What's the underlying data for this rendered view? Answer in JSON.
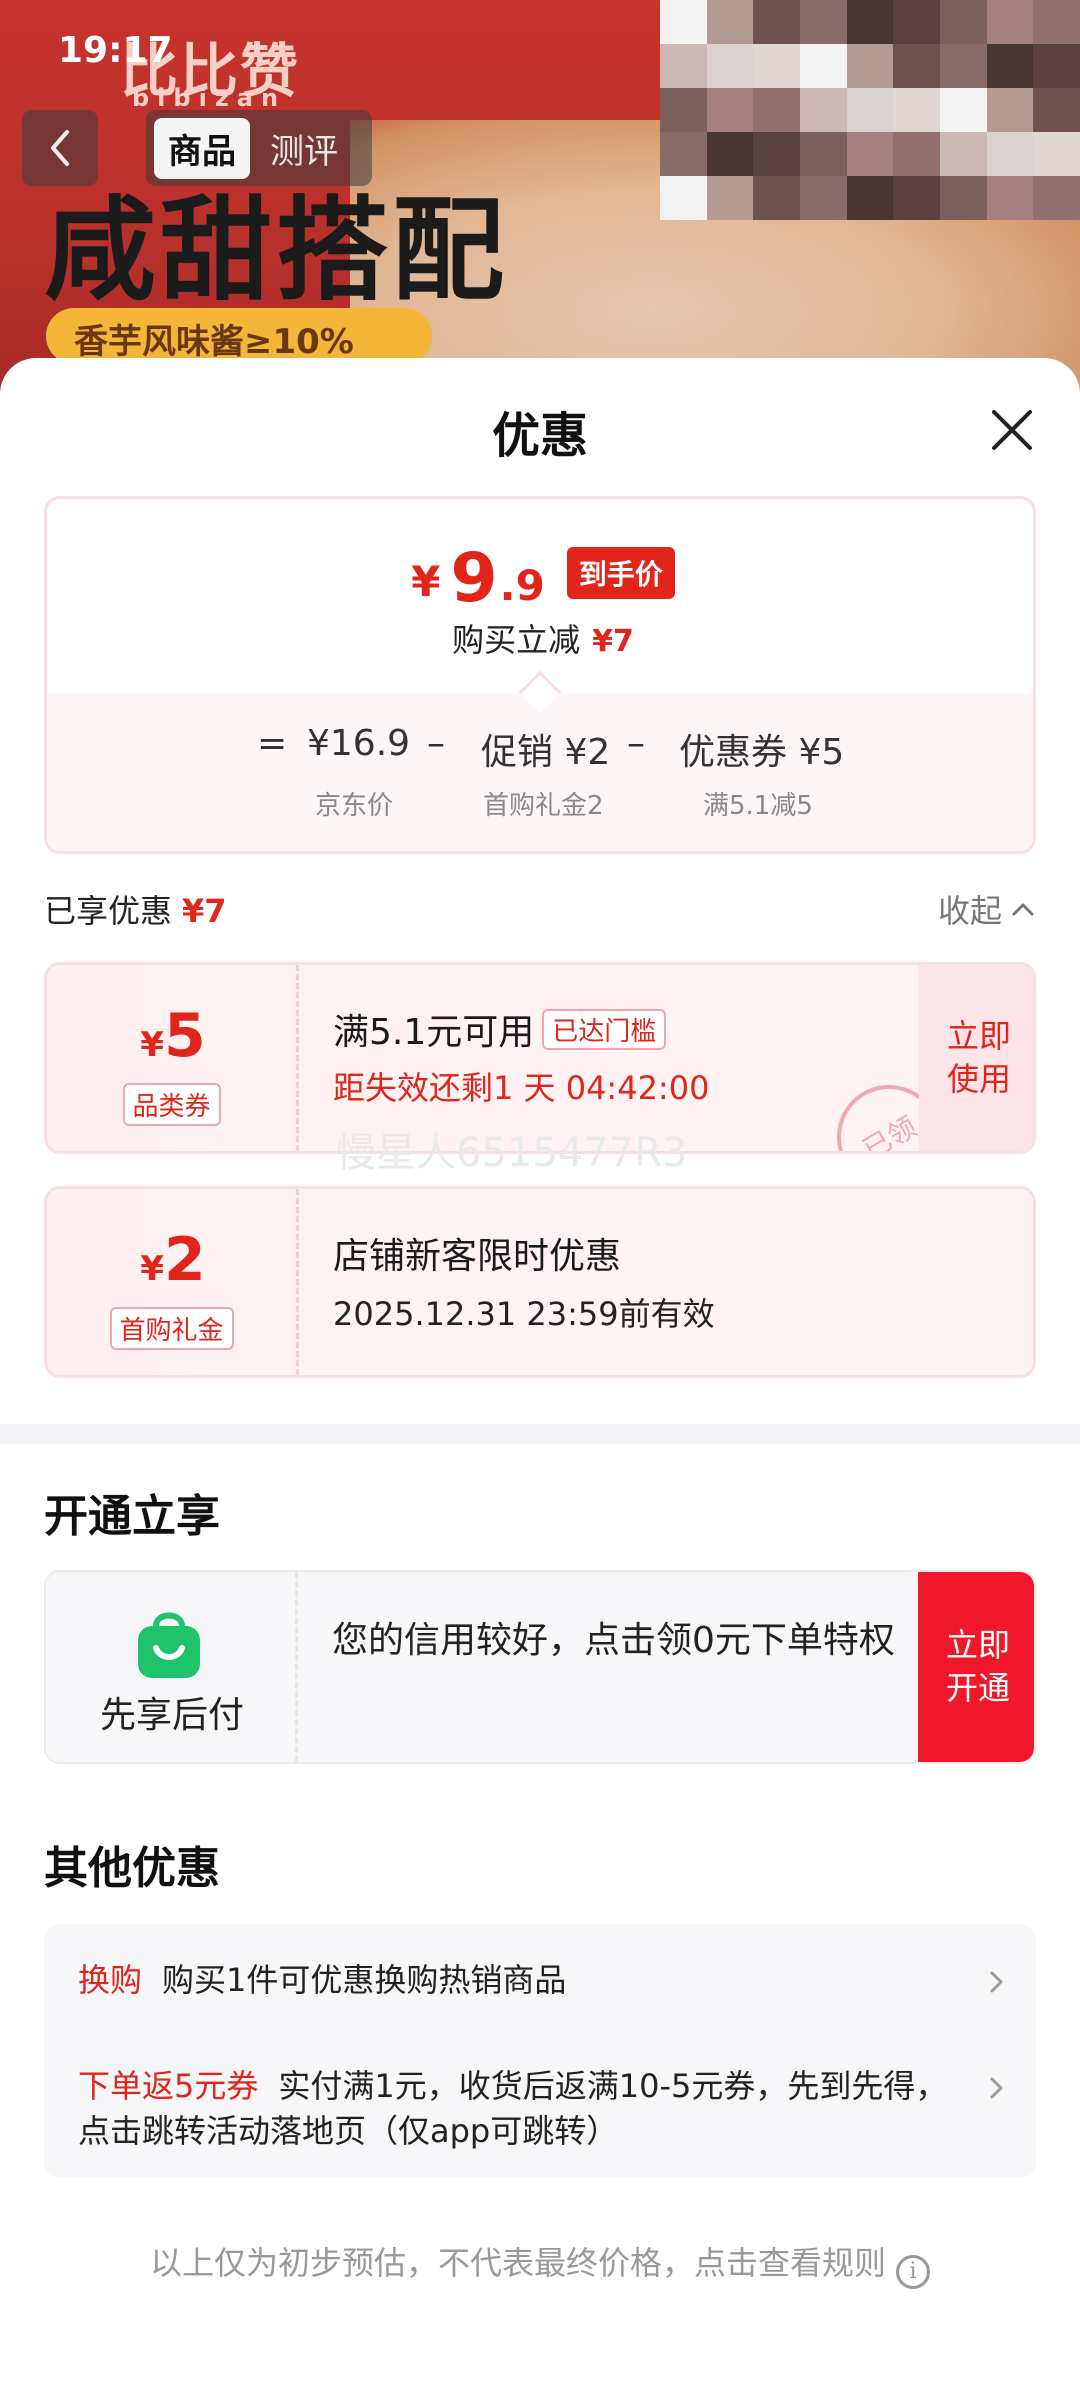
{
  "status_bar": {
    "time": "19:17"
  },
  "header": {
    "brand_name": "比比赞",
    "brand_sub": "bibizan",
    "tabs": [
      {
        "label": "商品"
      },
      {
        "label": "测评"
      }
    ],
    "headline": "咸甜搭配",
    "promo_pill": "香芋风味酱≥10%"
  },
  "sheet": {
    "title": "优惠",
    "price": {
      "currency": "¥",
      "integer": "9",
      "decimal": ".9",
      "tag": "到手价",
      "saving_label": "购买立减",
      "saving_value": "¥7"
    },
    "breakdown": {
      "eq": "=",
      "jd_price": "¥16.9",
      "minus1": "–",
      "promo": "促销 ¥2",
      "minus2": "–",
      "coupon": "优惠券 ¥5",
      "jd_price_label": "京东价",
      "promo_label": "首购礼金2",
      "coupon_label": "满5.1减5"
    },
    "enjoyed": {
      "label": "已享优惠",
      "value": "¥7",
      "collapse": "收起"
    },
    "coupons": [
      {
        "currency": "¥",
        "amount": "5",
        "type": "品类券",
        "title": "满5.1元可用",
        "badge": "已达门槛",
        "desc": "距失效还剩1 天 04:42:00",
        "action": "立即使用",
        "action_l1": "立即",
        "action_l2": "使用",
        "stamp": "已领"
      },
      {
        "currency": "¥",
        "amount": "2",
        "type": "首购礼金",
        "title": "店铺新客限时优惠",
        "desc": "2025.12.31 23:59前有效"
      }
    ],
    "watermark": "慢星人6515477R3",
    "open_section": {
      "title": "开通立享",
      "pay_label": "先享后付",
      "text": "您的信用较好，点击领0元下单特权",
      "button_l1": "立即",
      "button_l2": "开通"
    },
    "other_offers": {
      "title": "其他优惠",
      "items": [
        {
          "tag": "换购",
          "text": "购买1件可优惠换购热销商品"
        },
        {
          "tag": "下单返5元券",
          "text": "实付满1元，收货后返满10-5元券，先到先得，点击跳转活动落地页（仅app可跳转）"
        }
      ]
    },
    "footer_note": "以上仅为初步预估，不代表最终价格，点击查看规则"
  },
  "colors": {
    "accent": "#e1251b",
    "pay_green": "#1fc36a",
    "pill": "#f4b638"
  }
}
